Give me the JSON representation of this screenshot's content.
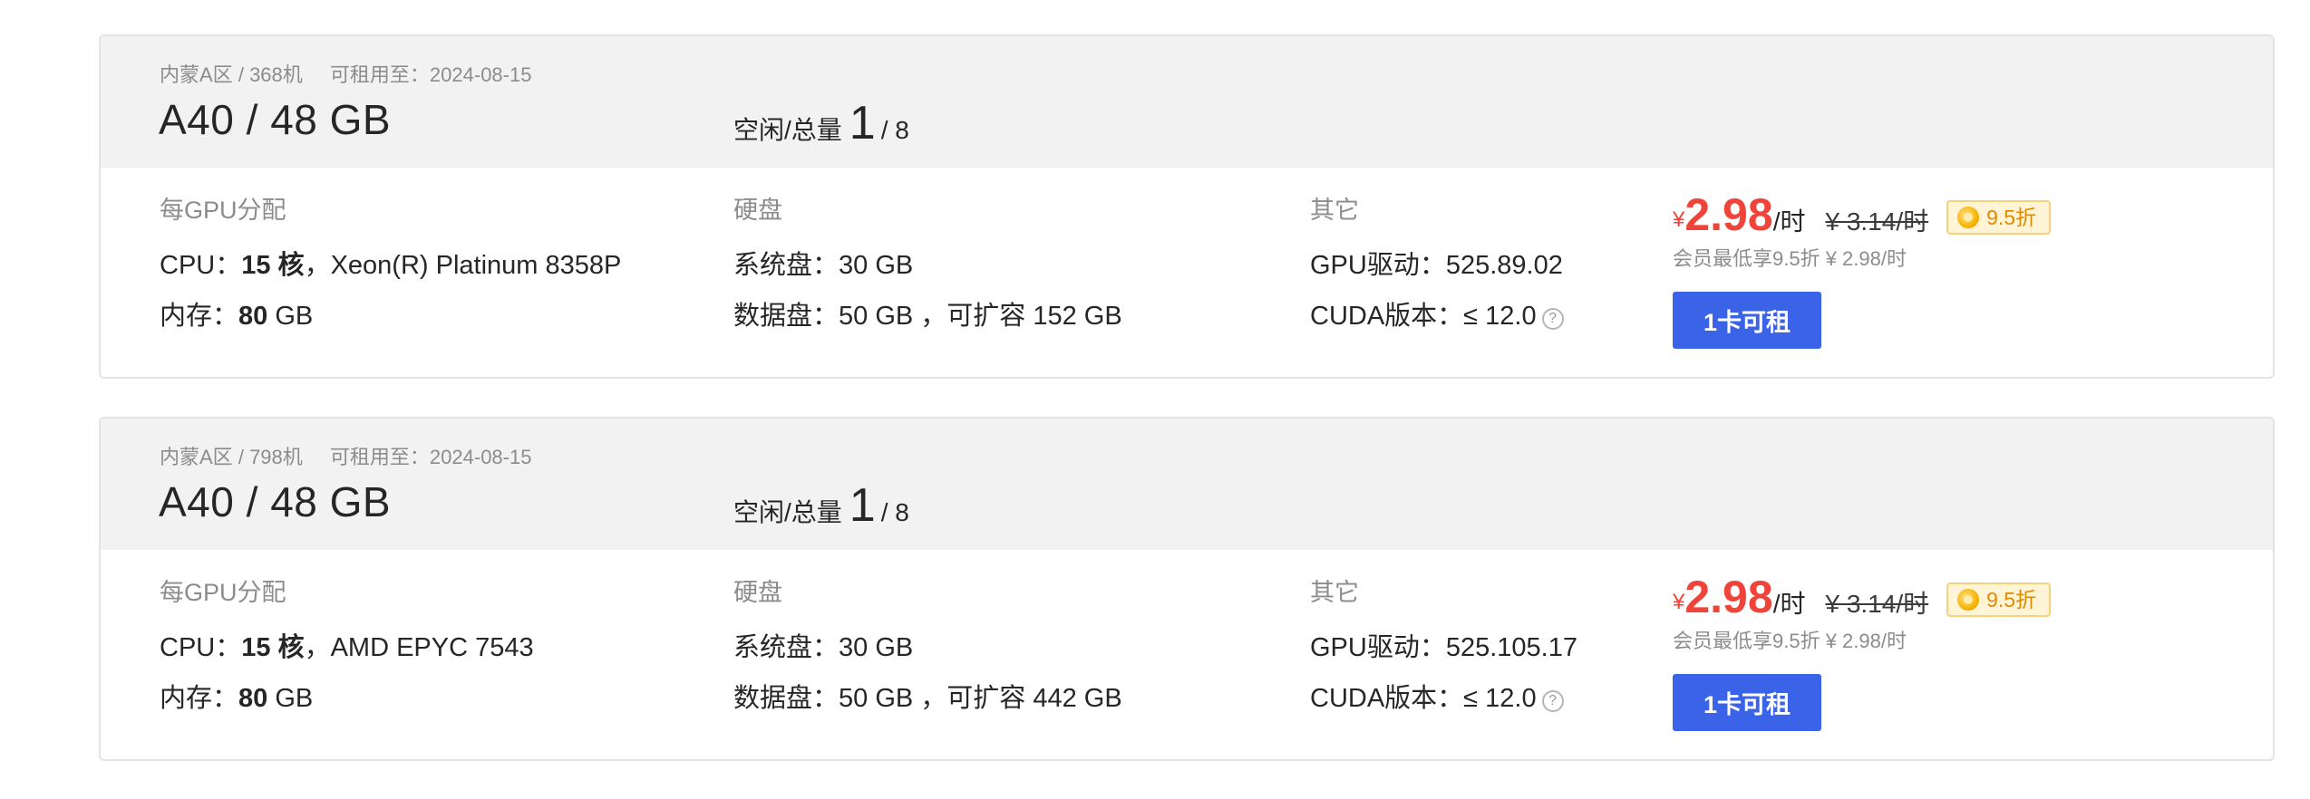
{
  "cards": [
    {
      "region": "内蒙A区",
      "separator": "/",
      "machine": "368机",
      "expire_label": "可租用至：",
      "expire_date": "2024-08-15",
      "gpu_title": "A40 / 48 GB",
      "avail_label": "空闲/总量",
      "free": "1",
      "total": "/ 8",
      "per_gpu": {
        "heading": "每GPU分配",
        "cpu_label": "CPU：",
        "cpu_cores": "15 核",
        "cpu_model": "，Xeon(R) Platinum 8358P",
        "mem_label": "内存：",
        "mem_value": "80",
        "mem_unit": " GB"
      },
      "disk": {
        "heading": "硬盘",
        "sys_label": "系统盘：",
        "sys_value": "30 GB",
        "data_label": "数据盘：",
        "data_value": "50 GB ，可扩容 152 GB"
      },
      "other": {
        "heading": "其它",
        "driver_label": "GPU驱动：",
        "driver_value": "525.89.02",
        "cuda_label": "CUDA版本：",
        "cuda_value": "≤ 12.0",
        "help_icon": "?"
      },
      "pricing": {
        "currency": "¥",
        "price": "2.98",
        "unit": "/时",
        "original": "¥ 3.14/时",
        "discount": "9.5折",
        "member_note": "会员最低享9.5折 ¥ 2.98/时",
        "button": "1卡可租"
      }
    },
    {
      "region": "内蒙A区",
      "separator": "/",
      "machine": "798机",
      "expire_label": "可租用至：",
      "expire_date": "2024-08-15",
      "gpu_title": "A40 / 48 GB",
      "avail_label": "空闲/总量",
      "free": "1",
      "total": "/ 8",
      "per_gpu": {
        "heading": "每GPU分配",
        "cpu_label": "CPU：",
        "cpu_cores": "15 核",
        "cpu_model": "，AMD EPYC 7543",
        "mem_label": "内存：",
        "mem_value": "80",
        "mem_unit": " GB"
      },
      "disk": {
        "heading": "硬盘",
        "sys_label": "系统盘：",
        "sys_value": "30 GB",
        "data_label": "数据盘：",
        "data_value": "50 GB ，可扩容 442 GB"
      },
      "other": {
        "heading": "其它",
        "driver_label": "GPU驱动：",
        "driver_value": "525.105.17",
        "cuda_label": "CUDA版本：",
        "cuda_value": "≤ 12.0",
        "help_icon": "?"
      },
      "pricing": {
        "currency": "¥",
        "price": "2.98",
        "unit": "/时",
        "original": "¥ 3.14/时",
        "discount": "9.5折",
        "member_note": "会员最低享9.5折 ¥ 2.98/时",
        "button": "1卡可租"
      }
    }
  ],
  "colors": {
    "accent": "#3b63e8",
    "price": "#f0443a",
    "header_bg": "#f2f2f2",
    "badge_bg": "#fff4d6",
    "badge_text": "#e08a00"
  },
  "icons": {
    "help": "question-circle-icon",
    "badge": "coin-icon"
  }
}
